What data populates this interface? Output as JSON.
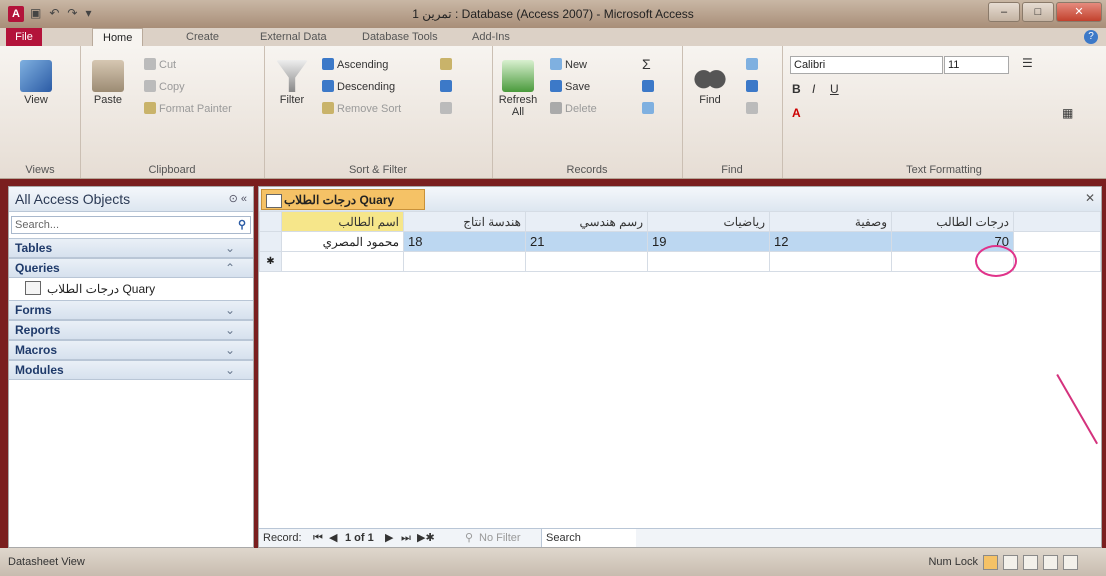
{
  "window": {
    "title": "تمرين 1 : Database (Access 2007) - Microsoft Access",
    "app_icon": "A",
    "controls": [
      "–",
      "□",
      "✕"
    ]
  },
  "ribbon_tabs": [
    "File",
    "Home",
    "Create",
    "External Data",
    "Database Tools",
    "Add-Ins"
  ],
  "groups": {
    "views": {
      "label": "Views",
      "view_btn": "View"
    },
    "clipboard": {
      "label": "Clipboard",
      "paste": "Paste",
      "cut": "Cut",
      "copy": "Copy",
      "format_painter": "Format Painter"
    },
    "sort_filter": {
      "label": "Sort & Filter",
      "filter": "Filter",
      "ascending": "Ascending",
      "descending": "Descending",
      "remove_sort": "Remove Sort"
    },
    "records": {
      "label": "Records",
      "refresh": "Refresh All",
      "new": "New",
      "save": "Save",
      "delete": "Delete"
    },
    "find": {
      "label": "Find",
      "find": "Find"
    },
    "text_formatting": {
      "label": "Text Formatting",
      "font": "Calibri",
      "size": "11"
    }
  },
  "nav_pane": {
    "title": "All Access Objects",
    "search_placeholder": "Search...",
    "categories": {
      "tables": "Tables",
      "queries": "Queries",
      "forms": "Forms",
      "reports": "Reports",
      "macros": "Macros",
      "modules": "Modules"
    },
    "query_item": "درجات الطلاب Quary"
  },
  "document": {
    "tab_title": "درجات الطلاب Quary",
    "columns": [
      "اسم الطالب",
      "هندسة انتاج",
      "رسم هندسي",
      "رياضيات",
      "وصفية",
      "درجات الطالب"
    ],
    "row": [
      "محمود المصري",
      "18",
      "21",
      "19",
      "12",
      "70"
    ]
  },
  "record_nav": {
    "label": "Record:",
    "position": "1 of 1",
    "filter": "No Filter",
    "search": "Search"
  },
  "status": {
    "view": "Datasheet View",
    "num_lock": "Num Lock"
  }
}
